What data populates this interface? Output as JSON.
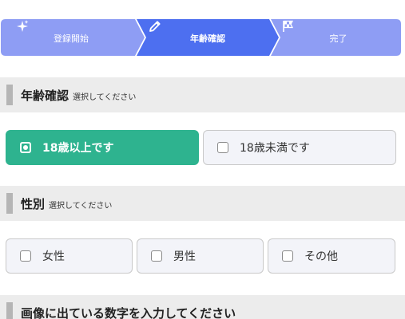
{
  "stepper": {
    "steps": [
      {
        "label": "登録開始",
        "icon": "sparkle-icon",
        "state": "done"
      },
      {
        "label": "年齢確認",
        "icon": "pencil-icon",
        "state": "active"
      },
      {
        "label": "完了",
        "icon": "checkered-flag-icon",
        "state": "pending"
      }
    ],
    "colors": {
      "done": "#8e9df4",
      "active": "#4d6ff0",
      "pending": "#8e9df4"
    }
  },
  "age_section": {
    "title": "年齢確認",
    "subtitle": "選択してください",
    "options": [
      {
        "label": "18歳以上です",
        "selected": true
      },
      {
        "label": "18歳未満です",
        "selected": false
      }
    ]
  },
  "gender_section": {
    "title": "性別",
    "subtitle": "選択してください",
    "options": [
      {
        "label": "女性",
        "selected": false
      },
      {
        "label": "男性",
        "selected": false
      },
      {
        "label": "その他",
        "selected": false
      }
    ]
  },
  "captcha_section": {
    "title": "画像に出ている数字を入力してください"
  },
  "colors": {
    "accent_selected": "#2eb38f",
    "section_bg": "#ececec",
    "option_bg": "#f3f4f9"
  }
}
